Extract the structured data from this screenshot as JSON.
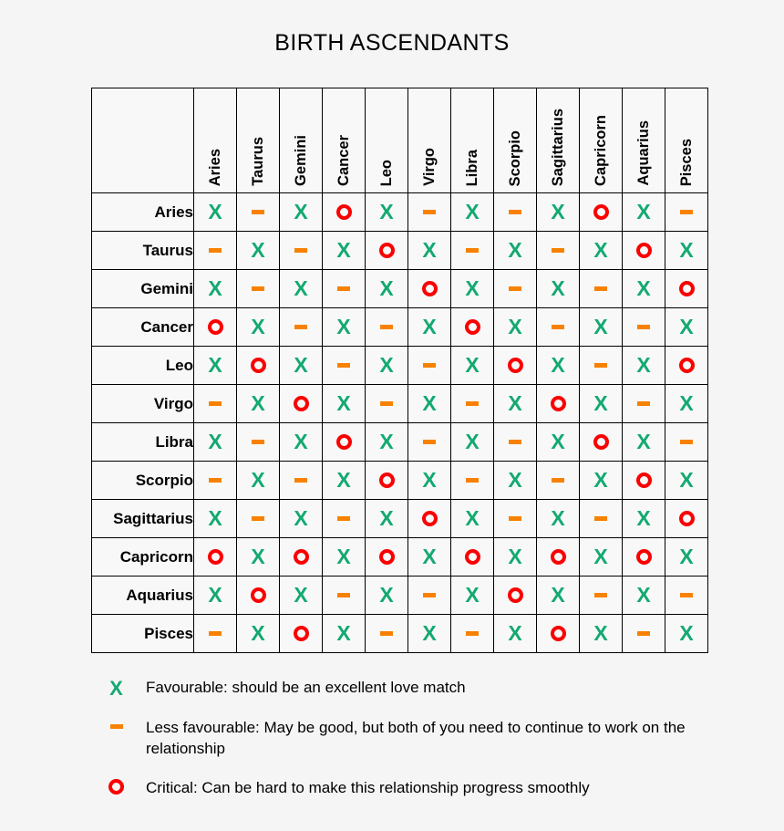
{
  "title": "BIRTH ASCENDANTS",
  "signs": [
    "Aries",
    "Taurus",
    "Gemini",
    "Cancer",
    "Leo",
    "Virgo",
    "Libra",
    "Scorpio",
    "Sagittarius",
    "Capricorn",
    "Aquarius",
    "Pisces"
  ],
  "symbol_colors": {
    "favourable": "#13a971",
    "less_favourable": "#f88100",
    "critical": "#fb0000",
    "background": "#f5f5f5",
    "cell_background": "#f8f8f8",
    "grid": "#000000"
  },
  "legend": [
    {
      "symbol": "x",
      "icon": "x-mark-icon",
      "text": "Favourable: should be an excellent love match"
    },
    {
      "symbol": "dash",
      "icon": "dash-icon",
      "text": "Less favourable: May be good, but both of you need to continue to work on the relationship"
    },
    {
      "symbol": "o",
      "icon": "circle-icon",
      "text": "Critical: Can be hard to make this relationship progress smoothly"
    }
  ],
  "chart_data": {
    "type": "heatmap",
    "title": "BIRTH ASCENDANTS",
    "xlabel": "",
    "ylabel": "",
    "categories": [
      "Aries",
      "Taurus",
      "Gemini",
      "Cancer",
      "Leo",
      "Virgo",
      "Libra",
      "Scorpio",
      "Sagittarius",
      "Capricorn",
      "Aquarius",
      "Pisces"
    ],
    "row_categories": [
      "Aries",
      "Taurus",
      "Gemini",
      "Cancer",
      "Leo",
      "Virgo",
      "Libra",
      "Scorpio",
      "Sagittarius",
      "Capricorn",
      "Aquarius",
      "Pisces"
    ],
    "value_legend": {
      "x": "Favourable: should be an excellent love match",
      "dash": "Less favourable: May be good, but both of you need to continue to work on the relationship",
      "o": "Critical: Can be hard to make this relationship progress smoothly"
    },
    "grid": true,
    "legend_position": "bottom",
    "rows": [
      {
        "label": "Aries",
        "values": [
          "x",
          "dash",
          "x",
          "o",
          "x",
          "dash",
          "x",
          "dash",
          "x",
          "o",
          "x",
          "dash"
        ]
      },
      {
        "label": "Taurus",
        "values": [
          "dash",
          "x",
          "dash",
          "x",
          "o",
          "x",
          "dash",
          "x",
          "dash",
          "x",
          "o",
          "x"
        ]
      },
      {
        "label": "Gemini",
        "values": [
          "x",
          "dash",
          "x",
          "dash",
          "x",
          "o",
          "x",
          "dash",
          "x",
          "dash",
          "x",
          "o"
        ]
      },
      {
        "label": "Cancer",
        "values": [
          "o",
          "x",
          "dash",
          "x",
          "dash",
          "x",
          "o",
          "x",
          "dash",
          "x",
          "dash",
          "x"
        ]
      },
      {
        "label": "Leo",
        "values": [
          "x",
          "o",
          "x",
          "dash",
          "x",
          "dash",
          "x",
          "o",
          "x",
          "dash",
          "x",
          "o"
        ]
      },
      {
        "label": "Virgo",
        "values": [
          "dash",
          "x",
          "o",
          "x",
          "dash",
          "x",
          "dash",
          "x",
          "o",
          "x",
          "dash",
          "x"
        ]
      },
      {
        "label": "Libra",
        "values": [
          "x",
          "dash",
          "x",
          "o",
          "x",
          "dash",
          "x",
          "dash",
          "x",
          "o",
          "x",
          "dash"
        ]
      },
      {
        "label": "Scorpio",
        "values": [
          "dash",
          "x",
          "dash",
          "x",
          "o",
          "x",
          "dash",
          "x",
          "dash",
          "x",
          "o",
          "x"
        ]
      },
      {
        "label": "Sagittarius",
        "values": [
          "x",
          "dash",
          "x",
          "dash",
          "x",
          "o",
          "x",
          "dash",
          "x",
          "dash",
          "x",
          "o"
        ]
      },
      {
        "label": "Capricorn",
        "values": [
          "o",
          "x",
          "o",
          "x",
          "o",
          "x",
          "o",
          "x",
          "o",
          "x",
          "o",
          "x"
        ]
      },
      {
        "label": "Aquarius",
        "values": [
          "x",
          "o",
          "x",
          "dash",
          "x",
          "dash",
          "x",
          "o",
          "x",
          "dash",
          "x",
          "dash"
        ]
      },
      {
        "label": "Pisces",
        "values": [
          "dash",
          "x",
          "o",
          "x",
          "dash",
          "x",
          "dash",
          "x",
          "o",
          "x",
          "dash",
          "x"
        ]
      }
    ]
  }
}
